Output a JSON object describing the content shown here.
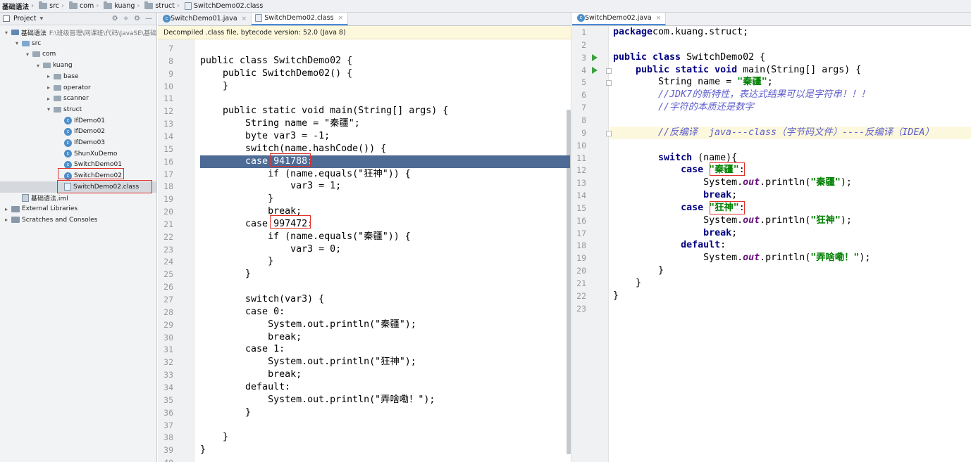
{
  "breadcrumbs": [
    "基础语法",
    "src",
    "com",
    "kuang",
    "struct",
    "SwitchDemo02.class"
  ],
  "project": {
    "header_label": "Project",
    "tools": [
      "⚙",
      "÷",
      "⚙",
      "—"
    ],
    "tree": [
      {
        "label": "基础语法",
        "path": "F:\\班级管理\\网课班\\代码\\JavaSE\\基础",
        "icon": "module",
        "arrow": "▾",
        "indent": 0
      },
      {
        "label": "src",
        "icon": "src-folder",
        "arrow": "▾",
        "indent": 1
      },
      {
        "label": "com",
        "icon": "folder",
        "arrow": "▾",
        "indent": 2
      },
      {
        "label": "kuang",
        "icon": "folder",
        "arrow": "▾",
        "indent": 3
      },
      {
        "label": "base",
        "icon": "folder",
        "arrow": "▸",
        "indent": 4
      },
      {
        "label": "operator",
        "icon": "folder",
        "arrow": "▸",
        "indent": 4
      },
      {
        "label": "scanner",
        "icon": "folder",
        "arrow": "▸",
        "indent": 4
      },
      {
        "label": "struct",
        "icon": "folder",
        "arrow": "▾",
        "indent": 4
      },
      {
        "label": "IfDemo01",
        "icon": "java-class",
        "arrow": "",
        "indent": 5
      },
      {
        "label": "IfDemo02",
        "icon": "java-class",
        "arrow": "",
        "indent": 5
      },
      {
        "label": "IfDemo03",
        "icon": "java-class",
        "arrow": "",
        "indent": 5
      },
      {
        "label": "ShunXuDemo",
        "icon": "java-class",
        "arrow": "",
        "indent": 5
      },
      {
        "label": "SwitchDemo01",
        "icon": "java-class",
        "arrow": "",
        "indent": 5
      },
      {
        "label": "SwitchDemo02",
        "icon": "java-class",
        "arrow": "",
        "indent": 5
      },
      {
        "label": "SwitchDemo02.class",
        "icon": "class-file",
        "arrow": "",
        "indent": 5,
        "selected": true
      },
      {
        "label": "基础语法.iml",
        "icon": "iml-file",
        "arrow": "",
        "indent": 1
      },
      {
        "label": "External Libraries",
        "icon": "library",
        "arrow": "▸",
        "indent": 0
      },
      {
        "label": "Scratches and Consoles",
        "icon": "scratch",
        "arrow": "▸",
        "indent": 0
      }
    ]
  },
  "left_editor": {
    "tabs": [
      {
        "label": "SwitchDemo01.java",
        "active": false
      },
      {
        "label": "SwitchDemo02.class",
        "active": true
      }
    ],
    "notice": "Decompiled .class file, bytecode version: 52.0 (Java 8)",
    "first_line": 7,
    "lines": [
      "",
      "public class SwitchDemo02 {",
      "    public SwitchDemo02() {",
      "    }",
      "",
      "    public static void main(String[] args) {",
      "        String name = \"秦疆\";",
      "        byte var3 = -1;",
      "        switch(name.hashCode()) {",
      "        case 941788:",
      "            if (name.equals(\"狂神\")) {",
      "                var3 = 1;",
      "            }",
      "            break;",
      "        case 997472:",
      "            if (name.equals(\"秦疆\")) {",
      "                var3 = 0;",
      "            }",
      "        }",
      "",
      "        switch(var3) {",
      "        case 0:",
      "            System.out.println(\"秦疆\");",
      "            break;",
      "        case 1:",
      "            System.out.println(\"狂神\");",
      "            break;",
      "        default:",
      "            System.out.println(\"弄啥嘞！\");",
      "        }",
      "",
      "    }",
      "}",
      ""
    ],
    "highlighted_line": 16
  },
  "right_editor": {
    "tabs": [
      {
        "label": "SwitchDemo02.java",
        "active": true
      }
    ],
    "first_line": 1,
    "lines": [
      [
        [
          "kw",
          "package"
        ],
        [
          "",
          "com.kuang.struct;"
        ]
      ],
      [],
      [
        [
          "kw",
          "public class"
        ],
        [
          "",
          " SwitchDemo02 {"
        ]
      ],
      [
        [
          "",
          "    "
        ],
        [
          "kw",
          "public static void"
        ],
        [
          "",
          " main(String[] args) {"
        ]
      ],
      [
        [
          "",
          "        String name = "
        ],
        [
          "str",
          "\"秦疆\""
        ],
        [
          "",
          ";"
        ]
      ],
      [
        [
          "cmt",
          "        //JDK7的新特性，表达式结果可以是字符串！！！"
        ]
      ],
      [
        [
          "cmt",
          "        //字符的本质还是数字"
        ]
      ],
      [],
      [
        [
          "cmt",
          "        //反编译  java---class（字节码文件）----反编译（IDEA）"
        ]
      ],
      [],
      [
        [
          "",
          "        "
        ],
        [
          "kw",
          "switch"
        ],
        [
          "",
          " (name){"
        ]
      ],
      [
        [
          "",
          "            "
        ],
        [
          "kw",
          "case"
        ],
        [
          "",
          " "
        ],
        [
          "str",
          "\"秦疆\""
        ],
        [
          "",
          ":"
        ]
      ],
      [
        [
          "",
          "                System."
        ],
        [
          "fld",
          "out"
        ],
        [
          "",
          ".println("
        ],
        [
          "str",
          "\"秦疆\""
        ],
        [
          "",
          ");"
        ]
      ],
      [
        [
          "",
          "                "
        ],
        [
          "kw",
          "break"
        ],
        [
          "",
          ";"
        ]
      ],
      [
        [
          "",
          "            "
        ],
        [
          "kw",
          "case"
        ],
        [
          "",
          " "
        ],
        [
          "str",
          "\"狂神\""
        ],
        [
          "",
          ":"
        ]
      ],
      [
        [
          "",
          "                System."
        ],
        [
          "fld",
          "out"
        ],
        [
          "",
          ".println("
        ],
        [
          "str",
          "\"狂神\""
        ],
        [
          "",
          ");"
        ]
      ],
      [
        [
          "",
          "                "
        ],
        [
          "kw",
          "break"
        ],
        [
          "",
          ";"
        ]
      ],
      [
        [
          "",
          "            "
        ],
        [
          "kw",
          "default"
        ],
        [
          "",
          ":"
        ]
      ],
      [
        [
          "",
          "                System."
        ],
        [
          "fld",
          "out"
        ],
        [
          "",
          ".println("
        ],
        [
          "str",
          "\"弄啥嘞！\""
        ],
        [
          "",
          ");"
        ]
      ],
      [
        [
          "",
          "        }"
        ]
      ],
      [
        [
          "",
          "    }"
        ]
      ],
      [
        [
          "",
          "}"
        ]
      ],
      []
    ],
    "caret_line": 9,
    "run_lines": [
      3,
      4
    ]
  },
  "colors": {
    "keyword": "#000080",
    "string": "#008000",
    "comment": "#5f5fcf",
    "field": "#660e7a",
    "selection": "#4d6b95",
    "annotation_box": "#e0322b"
  }
}
